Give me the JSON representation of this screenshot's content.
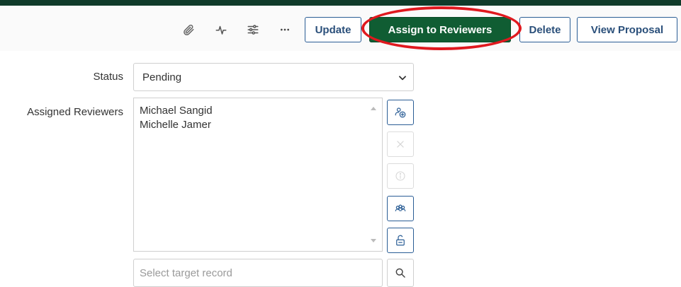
{
  "toolbar": {
    "icons": [
      "paperclip-icon",
      "activity-icon",
      "sliders-icon",
      "more-icon"
    ],
    "update_label": "Update",
    "assign_label": "Assign to Reviewers",
    "delete_label": "Delete",
    "view_proposal_label": "View Proposal"
  },
  "form": {
    "status_label": "Status",
    "status_value": "Pending",
    "reviewers_label": "Assigned Reviewers",
    "reviewers": [
      "Michael Sangid",
      "Michelle Jamer"
    ],
    "side_actions": [
      "add-reviewer-icon",
      "remove-icon",
      "info-icon",
      "group-icon",
      "lock-icon"
    ],
    "target_placeholder": "Select target record"
  },
  "colors": {
    "primary_green": "#105d33",
    "top_bar": "#0f3b2a",
    "outline_blue": "#2a5d95",
    "highlight_red": "#e0191f"
  }
}
